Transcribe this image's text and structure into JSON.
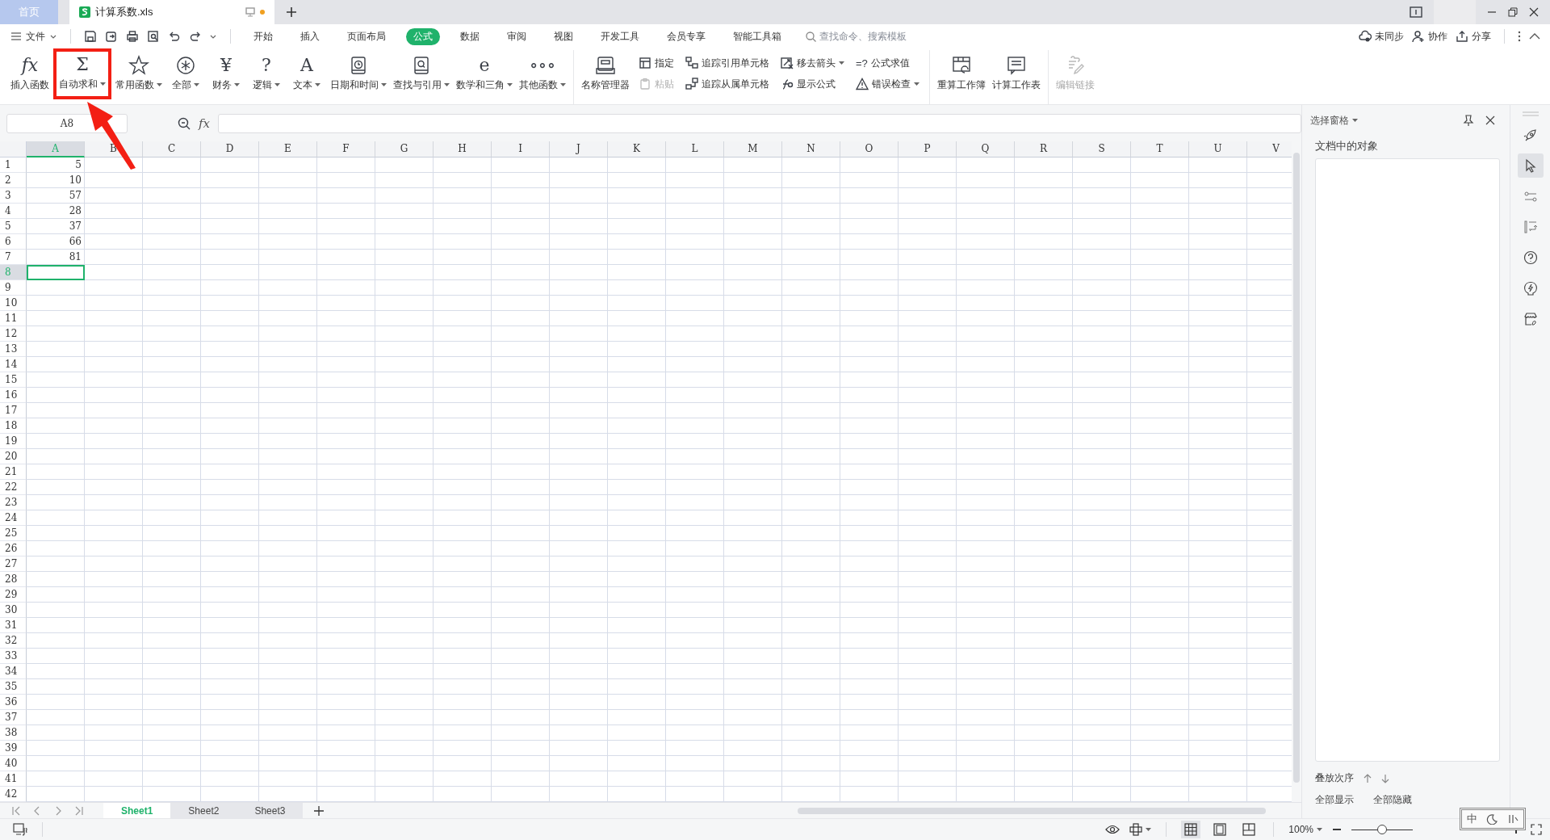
{
  "tabs": [
    {
      "kind": "home",
      "label": "首页",
      "selected": false
    },
    {
      "kind": "file",
      "label": "计算系数.xls",
      "selected": true,
      "modified": true
    }
  ],
  "menu": {
    "file": "文件",
    "tabs": [
      {
        "label": "开始",
        "selected": false
      },
      {
        "label": "插入",
        "selected": false
      },
      {
        "label": "页面布局",
        "selected": false
      },
      {
        "label": "公式",
        "selected": true
      },
      {
        "label": "数据",
        "selected": false
      },
      {
        "label": "审阅",
        "selected": false
      },
      {
        "label": "视图",
        "selected": false
      },
      {
        "label": "开发工具",
        "selected": false
      },
      {
        "label": "会员专享",
        "selected": false
      },
      {
        "label": "智能工具箱",
        "selected": false
      }
    ],
    "search": {
      "placeholder": "查找命令、搜索模板"
    },
    "actions": [
      "未同步",
      "协作",
      "分享"
    ]
  },
  "ribbon": [
    {
      "items": [
        {
          "kind": "large",
          "glyph": "fx",
          "label": "插入函数",
          "dropdown": false
        },
        {
          "kind": "large",
          "glyph": "Σ",
          "label": "自动求和",
          "dropdown": true,
          "highlighted": true
        },
        {
          "kind": "large",
          "label": "常用函数",
          "dropdown": true
        },
        {
          "kind": "large",
          "label": "全部",
          "dropdown": true
        },
        {
          "kind": "large",
          "glyph": "¥",
          "label": "财务",
          "dropdown": true
        },
        {
          "kind": "large",
          "glyph": "?",
          "label": "逻辑",
          "dropdown": true
        },
        {
          "kind": "large",
          "glyph": "A",
          "label": "文本",
          "dropdown": true
        },
        {
          "kind": "large",
          "label": "日期和时间",
          "dropdown": true
        },
        {
          "kind": "large",
          "label": "查找与引用",
          "dropdown": true
        },
        {
          "kind": "large",
          "glyph": "e",
          "label": "数学和三角",
          "dropdown": true
        },
        {
          "kind": "large",
          "glyph": "∘∘∘",
          "label": "其他函数",
          "dropdown": true
        }
      ]
    },
    {
      "items": [
        {
          "kind": "large",
          "label": "名称管理器",
          "dropdown": false
        },
        {
          "kind": "stack",
          "buttons": [
            {
              "label": "指定",
              "dropdown": false,
              "disabled": false
            },
            {
              "label": "粘贴",
              "dropdown": false,
              "disabled": true
            }
          ]
        },
        {
          "kind": "stack",
          "buttons": [
            {
              "label": "追踪引用单元格",
              "dropdown": false,
              "disabled": false
            },
            {
              "label": "追踪从属单元格",
              "dropdown": false,
              "disabled": false
            }
          ]
        },
        {
          "kind": "stack",
          "buttons": [
            {
              "label": "移去箭头",
              "dropdown": true,
              "disabled": false
            },
            {
              "label": "显示公式",
              "dropdown": false,
              "disabled": false
            }
          ]
        },
        {
          "kind": "stack",
          "buttons": [
            {
              "glyph": "=?",
              "label": "公式求值",
              "dropdown": false,
              "disabled": false
            },
            {
              "label": "错误检查",
              "dropdown": true,
              "disabled": false
            }
          ]
        }
      ]
    },
    {
      "items": [
        {
          "kind": "large",
          "label": "重算工作簿",
          "dropdown": false
        },
        {
          "kind": "large",
          "label": "计算工作表",
          "dropdown": false
        }
      ]
    },
    {
      "items": [
        {
          "kind": "large",
          "label": "编辑链接",
          "dropdown": false,
          "disabled": true
        }
      ]
    }
  ],
  "formula_bar": {
    "name_box": "A8",
    "fx": "fx"
  },
  "columns": [
    {
      "label": "A",
      "selected": true
    },
    {
      "label": "B",
      "selected": false
    },
    {
      "label": "C",
      "selected": false
    },
    {
      "label": "D",
      "selected": false
    },
    {
      "label": "E",
      "selected": false
    },
    {
      "label": "F",
      "selected": false
    },
    {
      "label": "G",
      "selected": false
    },
    {
      "label": "H",
      "selected": false
    },
    {
      "label": "I",
      "selected": false
    },
    {
      "label": "J",
      "selected": false
    },
    {
      "label": "K",
      "selected": false
    },
    {
      "label": "L",
      "selected": false
    },
    {
      "label": "M",
      "selected": false
    },
    {
      "label": "N",
      "selected": false
    },
    {
      "label": "O",
      "selected": false
    },
    {
      "label": "P",
      "selected": false
    },
    {
      "label": "Q",
      "selected": false
    },
    {
      "label": "R",
      "selected": false
    },
    {
      "label": "S",
      "selected": false
    },
    {
      "label": "T",
      "selected": false
    },
    {
      "label": "U",
      "selected": false
    },
    {
      "label": "V",
      "selected": false
    }
  ],
  "rows": [
    {
      "label": "1",
      "selected": false,
      "cells": [
        "5"
      ]
    },
    {
      "label": "2",
      "selected": false,
      "cells": [
        "10"
      ]
    },
    {
      "label": "3",
      "selected": false,
      "cells": [
        "57"
      ]
    },
    {
      "label": "4",
      "selected": false,
      "cells": [
        "28"
      ]
    },
    {
      "label": "5",
      "selected": false,
      "cells": [
        "37"
      ]
    },
    {
      "label": "6",
      "selected": false,
      "cells": [
        "66"
      ]
    },
    {
      "label": "7",
      "selected": false,
      "cells": [
        "81"
      ]
    },
    {
      "label": "8",
      "selected": true
    },
    {
      "label": "9",
      "selected": false
    },
    {
      "label": "10",
      "selected": false
    },
    {
      "label": "11",
      "selected": false
    },
    {
      "label": "12",
      "selected": false
    },
    {
      "label": "13",
      "selected": false
    },
    {
      "label": "14",
      "selected": false
    },
    {
      "label": "15",
      "selected": false
    },
    {
      "label": "16",
      "selected": false
    },
    {
      "label": "17",
      "selected": false
    },
    {
      "label": "18",
      "selected": false
    },
    {
      "label": "19",
      "selected": false
    },
    {
      "label": "20",
      "selected": false
    },
    {
      "label": "21",
      "selected": false
    },
    {
      "label": "22",
      "selected": false
    },
    {
      "label": "23",
      "selected": false
    },
    {
      "label": "24",
      "selected": false
    },
    {
      "label": "25",
      "selected": false
    },
    {
      "label": "26",
      "selected": false
    },
    {
      "label": "27",
      "selected": false
    },
    {
      "label": "28",
      "selected": false
    },
    {
      "label": "29",
      "selected": false
    },
    {
      "label": "30",
      "selected": false
    },
    {
      "label": "31",
      "selected": false
    },
    {
      "label": "32",
      "selected": false
    },
    {
      "label": "33",
      "selected": false
    },
    {
      "label": "34",
      "selected": false
    },
    {
      "label": "35",
      "selected": false
    },
    {
      "label": "36",
      "selected": false
    },
    {
      "label": "37",
      "selected": false
    },
    {
      "label": "38",
      "selected": false
    },
    {
      "label": "39",
      "selected": false
    },
    {
      "label": "40",
      "selected": false
    },
    {
      "label": "41",
      "selected": false
    },
    {
      "label": "42",
      "selected": false
    }
  ],
  "sheets": [
    {
      "label": "Sheet1",
      "selected": true
    },
    {
      "label": "Sheet2",
      "selected": false
    },
    {
      "label": "Sheet3",
      "selected": false
    }
  ],
  "side_panel": {
    "title": "选择窗格",
    "heading": "文档中的对象",
    "order_label": "叠放次序",
    "buttons": [
      "全部显示",
      "全部隐藏"
    ]
  },
  "side_tools": [
    {
      "selected": false
    },
    {
      "selected": true
    },
    {
      "selected": false
    },
    {
      "selected": false
    },
    {
      "selected": false
    },
    {
      "selected": false
    },
    {
      "selected": false
    }
  ],
  "status_bar": {
    "zoom": "100%",
    "level": 0.5,
    "views": [
      {
        "selected": true
      },
      {
        "selected": false
      },
      {
        "selected": false
      }
    ]
  },
  "ime_bar": {
    "label": "中"
  }
}
